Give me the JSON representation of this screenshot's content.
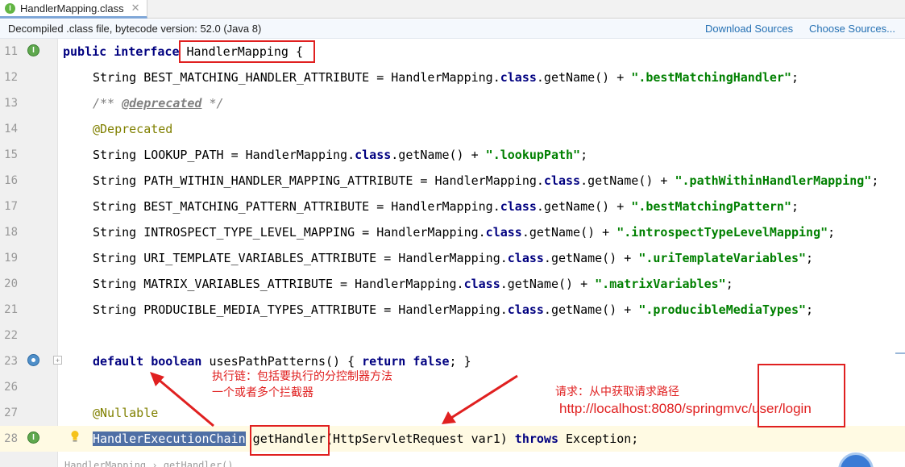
{
  "tab": {
    "icon_letter": "I",
    "title": "HandlerMapping.class",
    "close": "✕"
  },
  "banner": {
    "text": "Decompiled .class file, bytecode version: 52.0 (Java 8)",
    "download_sources": "Download Sources",
    "choose_sources": "Choose Sources..."
  },
  "code": {
    "line11": {
      "num": "11",
      "kw1": "public",
      "kw2": "interface",
      "name": "HandlerMapping {"
    },
    "line12": {
      "num": "12",
      "pre": "String BEST_MATCHING_HANDLER_ATTRIBUTE = HandlerMapping.",
      "cls": "class",
      "mid": ".getName() + ",
      "str": "\".bestMatchingHandler\"",
      "end": ";"
    },
    "line13": {
      "num": "13",
      "c1": "/** ",
      "doc": "@deprecated",
      "c2": " */"
    },
    "line14": {
      "num": "14",
      "ann": "@Deprecated"
    },
    "line15": {
      "num": "15",
      "pre": "String LOOKUP_PATH = HandlerMapping.",
      "cls": "class",
      "mid": ".getName() + ",
      "str": "\".lookupPath\"",
      "end": ";"
    },
    "line16": {
      "num": "16",
      "pre": "String PATH_WITHIN_HANDLER_MAPPING_ATTRIBUTE = HandlerMapping.",
      "cls": "class",
      "mid": ".getName() + ",
      "str": "\".pathWithinHandlerMapping\"",
      "end": ";"
    },
    "line17": {
      "num": "17",
      "pre": "String BEST_MATCHING_PATTERN_ATTRIBUTE = HandlerMapping.",
      "cls": "class",
      "mid": ".getName() + ",
      "str": "\".bestMatchingPattern\"",
      "end": ";"
    },
    "line18": {
      "num": "18",
      "pre": "String INTROSPECT_TYPE_LEVEL_MAPPING = HandlerMapping.",
      "cls": "class",
      "mid": ".getName() + ",
      "str": "\".introspectTypeLevelMapping\"",
      "end": ";"
    },
    "line19": {
      "num": "19",
      "pre": "String URI_TEMPLATE_VARIABLES_ATTRIBUTE = HandlerMapping.",
      "cls": "class",
      "mid": ".getName() + ",
      "str": "\".uriTemplateVariables\"",
      "end": ";"
    },
    "line20": {
      "num": "20",
      "pre": "String MATRIX_VARIABLES_ATTRIBUTE = HandlerMapping.",
      "cls": "class",
      "mid": ".getName() + ",
      "str": "\".matrixVariables\"",
      "end": ";"
    },
    "line21": {
      "num": "21",
      "pre": "String PRODUCIBLE_MEDIA_TYPES_ATTRIBUTE = HandlerMapping.",
      "cls": "class",
      "mid": ".getName() + ",
      "str": "\".producibleMediaTypes\"",
      "end": ";"
    },
    "line22": {
      "num": "22"
    },
    "line23": {
      "num": "23",
      "kw1": "default",
      "kw2": "boolean",
      "mid": " usesPathPatterns() { ",
      "kw3": "return",
      "kw4": "false",
      "end": "; }"
    },
    "line26": {
      "num": "26"
    },
    "line27": {
      "num": "27",
      "ann": "@Nullable"
    },
    "line28": {
      "num": "28",
      "sel": "HandlerExecutionChain",
      "mid": " getHandler(HttpServletRequest var1) ",
      "kw": "throws",
      "end": " Exception;"
    }
  },
  "annotations": {
    "note1_line1": "执行链：包括要执行的分控制器方法",
    "note1_line2": "一个或者多个拦截器",
    "note2_line1": "请求：从中获取请求路径",
    "note2_line2": "http://localhost:8080/springmvc/user/login"
  },
  "bottom_hint": "HandlerMapping › getHandler()",
  "colors": {
    "keyword": "#000080",
    "string": "#008000",
    "annotation_red": "#e02020",
    "selection": "#4f6fa5"
  }
}
